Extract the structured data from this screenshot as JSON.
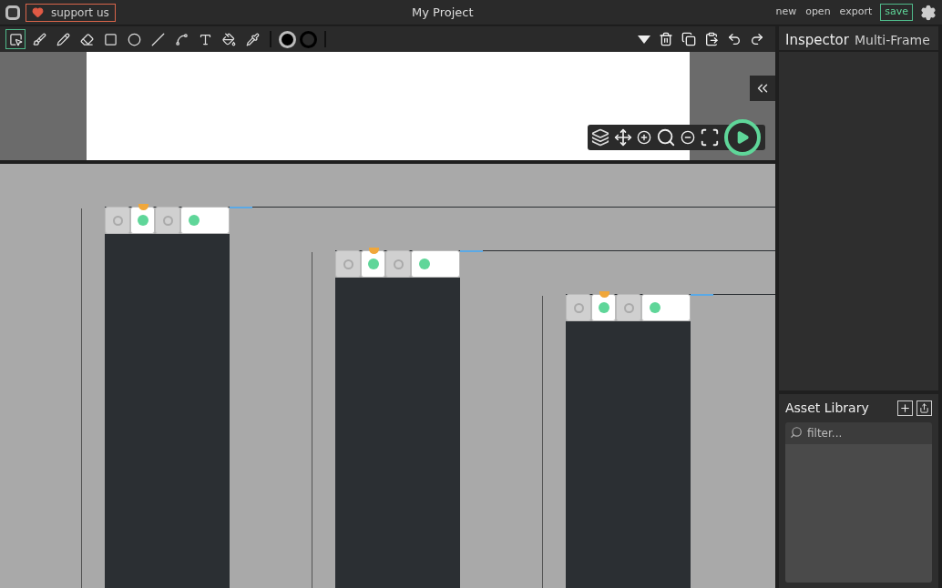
{
  "header": {
    "support_label": "support us",
    "title": "My Project",
    "menu": [
      {
        "label": "new"
      },
      {
        "label": "open"
      },
      {
        "label": "export"
      }
    ],
    "save_label": "save"
  },
  "tools": [
    {
      "kind": "select",
      "selected": true
    },
    {
      "kind": "brush",
      "selected": false
    },
    {
      "kind": "pencil",
      "selected": false
    },
    {
      "kind": "eraser",
      "selected": false
    },
    {
      "kind": "rectangle",
      "selected": false
    },
    {
      "kind": "ellipse",
      "selected": false
    },
    {
      "kind": "line",
      "selected": false
    },
    {
      "kind": "path",
      "selected": false
    },
    {
      "kind": "text",
      "selected": false
    },
    {
      "kind": "fill",
      "selected": false
    },
    {
      "kind": "eyedropper",
      "selected": false
    }
  ],
  "inspector": {
    "title": "Inspector",
    "subtitle": "Multi-Frame"
  },
  "assets": {
    "title": "Asset Library",
    "placeholder": "filter..."
  },
  "timelines": [
    {
      "frames": [
        {
          "kind": "empty",
          "marker": false
        },
        {
          "kind": "filled",
          "marker": true
        },
        {
          "kind": "empty",
          "marker": false
        },
        {
          "kind": "filled",
          "marker": false
        }
      ]
    },
    {
      "frames": [
        {
          "kind": "empty",
          "marker": false
        },
        {
          "kind": "filled",
          "marker": true
        },
        {
          "kind": "empty",
          "marker": false
        },
        {
          "kind": "filled",
          "marker": false
        }
      ]
    },
    {
      "frames": [
        {
          "kind": "empty",
          "marker": false
        },
        {
          "kind": "filled",
          "marker": true
        },
        {
          "kind": "empty",
          "marker": false
        },
        {
          "kind": "filled",
          "marker": false
        }
      ]
    }
  ]
}
